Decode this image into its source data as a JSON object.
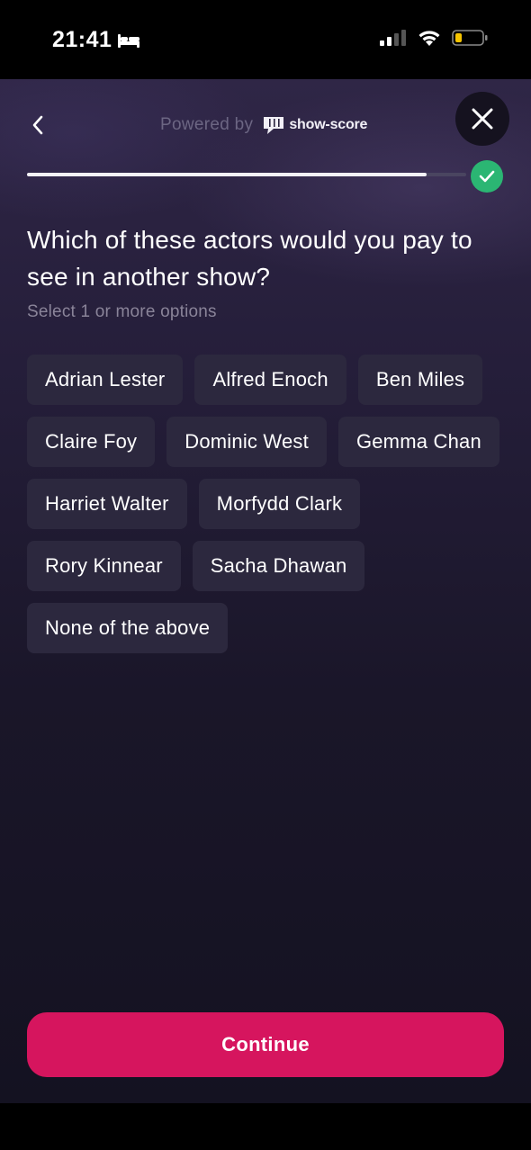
{
  "status_bar": {
    "time": "21:41",
    "icons": [
      "bed-icon",
      "signal-icon",
      "wifi-icon",
      "battery-icon"
    ],
    "battery_color": "#f5c400"
  },
  "header": {
    "back_icon": "chevron-left-icon",
    "powered_by": "Powered by",
    "brand_name": "show-score",
    "close_icon": "close-icon"
  },
  "progress": {
    "fraction": 0.91,
    "complete_icon": "check-icon",
    "complete_color": "#2bb673"
  },
  "question": {
    "title": "Which of these actors would you pay to see in another show?",
    "hint": "Select 1 or more options"
  },
  "options": [
    "Adrian Lester",
    "Alfred Enoch",
    "Ben Miles",
    "Claire Foy",
    "Dominic West",
    "Gemma Chan",
    "Harriet Walter",
    "Morfydd Clark",
    "Rory Kinnear",
    "Sacha Dhawan",
    "None of the above"
  ],
  "footer": {
    "continue_label": "Continue",
    "accent_color": "#d6155e"
  }
}
